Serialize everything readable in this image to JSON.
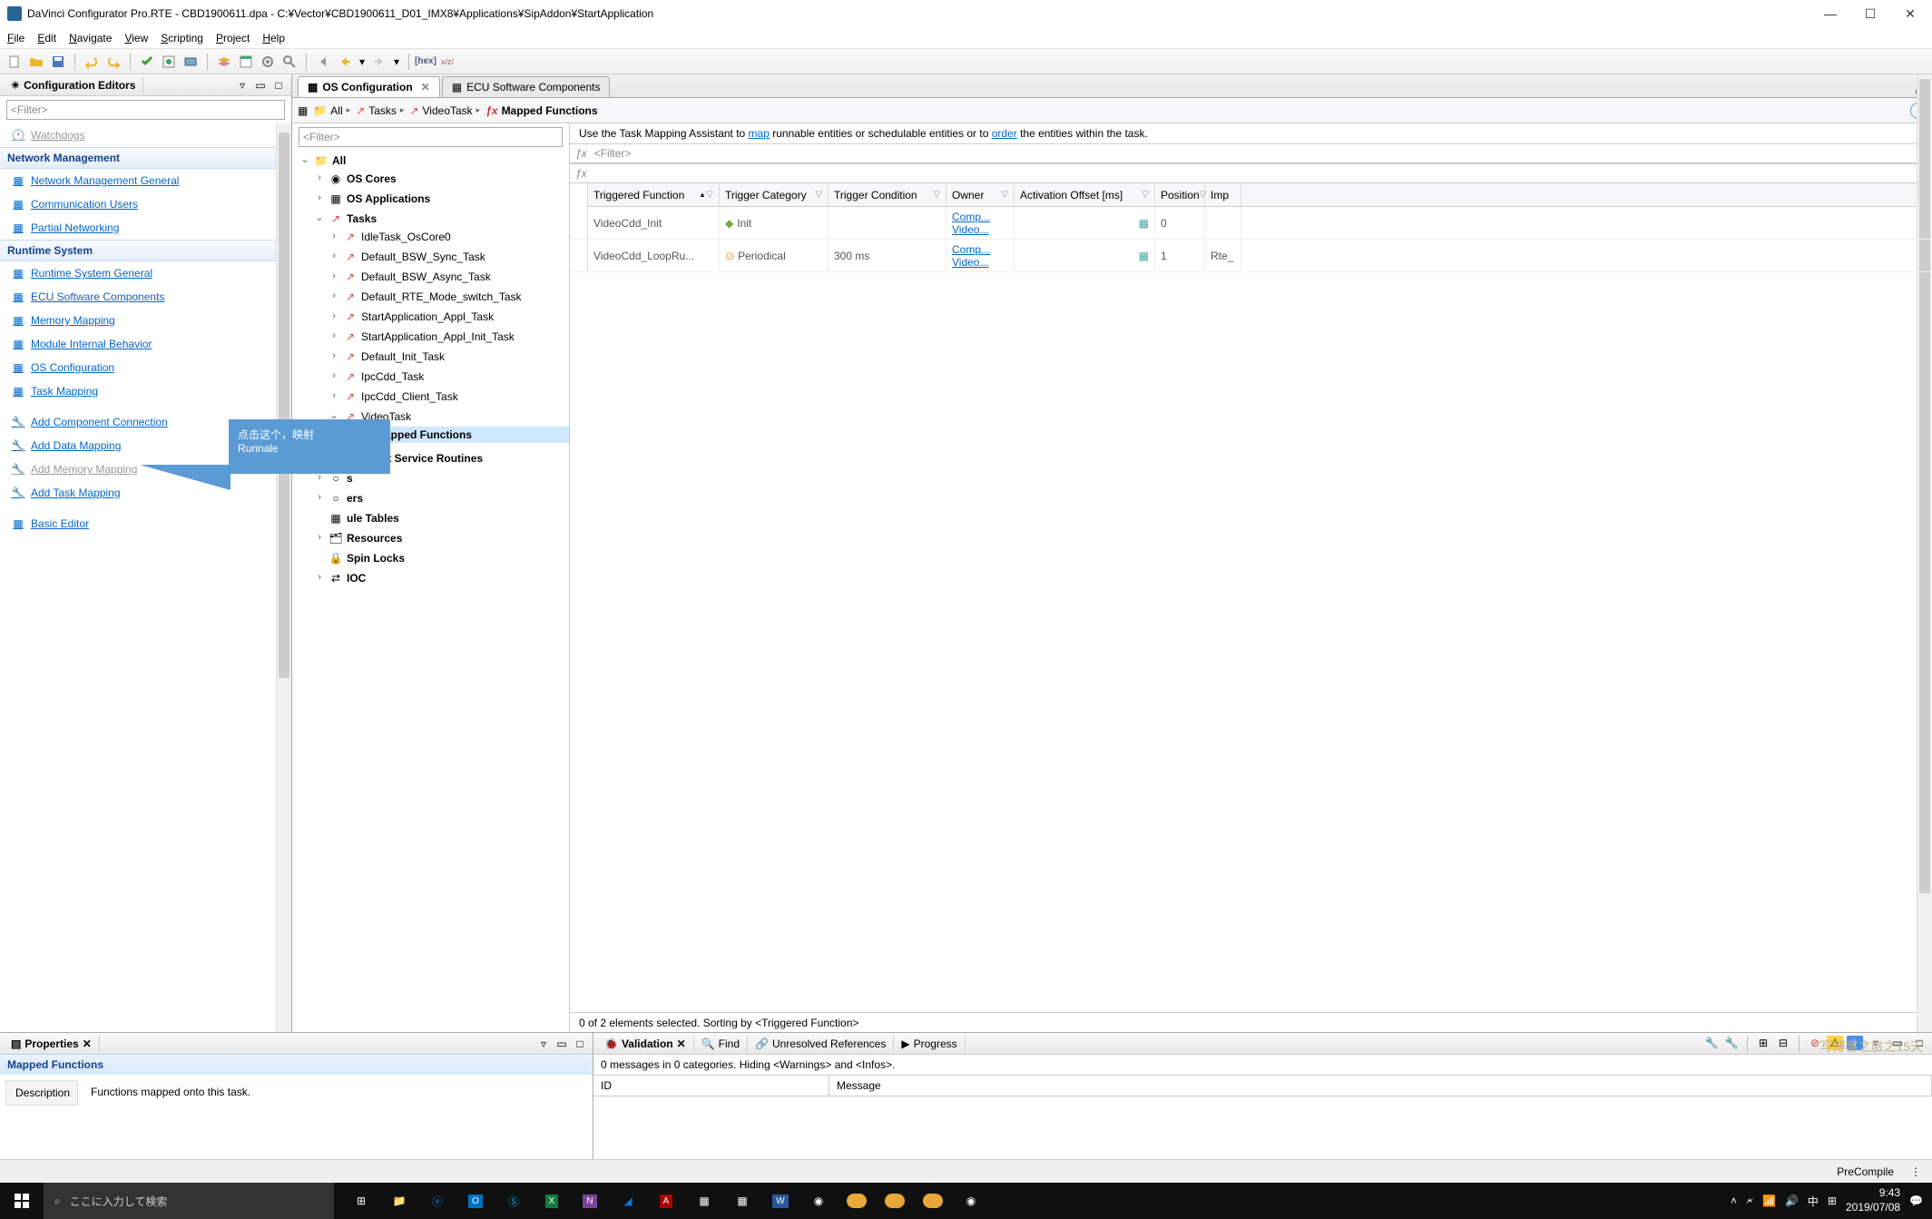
{
  "titlebar": {
    "text": "DaVinci Configurator Pro.RTE - CBD1900611.dpa - C:¥Vector¥CBD1900611_D01_IMX8¥Applications¥SipAddon¥StartApplication"
  },
  "menubar": {
    "file": "File",
    "edit": "Edit",
    "navigate": "Navigate",
    "view": "View",
    "scripting": "Scripting",
    "project": "Project",
    "help": "Help"
  },
  "config_editors": {
    "title": "Configuration Editors",
    "filter": "<Filter>",
    "watchdogs": "Watchdogs",
    "network_cat": "Network Management",
    "nm_general": "Network Management General",
    "comm_users": "Communication Users",
    "partial_net": "Partial Networking",
    "runtime_cat": "Runtime System",
    "rs_general": "Runtime System General",
    "ecu_sw": "ECU Software Components",
    "mem_map": "Memory Mapping",
    "module_behavior": "Module Internal Behavior",
    "os_config": "OS Configuration",
    "task_mapping": "Task Mapping",
    "add_comp": "Add Component Connection",
    "add_data": "Add Data Mapping",
    "add_mem": "Add Memory Mapping",
    "add_task": "Add Task Mapping",
    "basic_editor": "Basic Editor"
  },
  "editor": {
    "tab1": "OS Configuration",
    "tab2": "ECU Software Components",
    "bc_all": "All",
    "bc_tasks": "Tasks",
    "bc_vtask": "VideoTask",
    "bc_mf": "Mapped Functions"
  },
  "tree": {
    "filter": "<Filter>",
    "all": "All",
    "os_cores": "OS Cores",
    "os_apps": "OS Applications",
    "tasks": "Tasks",
    "idle": "IdleTask_OsCore0",
    "bsw_sync": "Default_BSW_Sync_Task",
    "bsw_async": "Default_BSW_Async_Task",
    "rte_mode": "Default_RTE_Mode_switch_Task",
    "appl": "StartApplication_Appl_Task",
    "appl_init": "StartApplication_Appl_Init_Task",
    "def_init": "Default_Init_Task",
    "ipc": "IpcCdd_Task",
    "ipc_client": "IpcCdd_Client_Task",
    "video": "VideoTask",
    "mapped_fn": "Mapped Functions",
    "isr": "Interrupt Service Routines",
    "suffix_s": "s",
    "suffix_ers": "ers",
    "sched": "ule Tables",
    "resources": "Resources",
    "spinlocks": "Spin Locks",
    "ioc": "IOC"
  },
  "hint": {
    "pre": "Use the Task Mapping Assistant to ",
    "map": "map",
    "mid": " runnable entities or schedulable entities or to ",
    "order": "order",
    "post": " the entities within the task."
  },
  "grid": {
    "filter": "<Filter>",
    "col_tf": "Triggered Function",
    "col_tc": "Trigger Category",
    "col_cond": "Trigger Condition",
    "col_owner": "Owner",
    "col_ao": "Activation Offset [ms]",
    "col_pos": "Position",
    "col_imp": "Imp",
    "r0_tf": "VideoCdd_Init",
    "r0_tc": "Init",
    "r0_owner1": "Comp...",
    "r0_owner2": "Video...",
    "r0_pos": "0",
    "r1_tf": "VideoCdd_LoopRu...",
    "r1_tc": "Periodical",
    "r1_cond": "300 ms",
    "r1_owner1": "Comp...",
    "r1_owner2": "Video...",
    "r1_pos": "1",
    "r1_imp": "Rte_",
    "status": "0 of 2 elements selected. Sorting by <Triggered Function>"
  },
  "properties": {
    "tab": "Properties",
    "title": "Mapped Functions",
    "desc_label": "Description",
    "desc_value": "Functions mapped onto this task."
  },
  "validation": {
    "tab_valid": "Validation",
    "tab_find": "Find",
    "tab_unres": "Unresolved References",
    "tab_prog": "Progress",
    "msg": "0 messages in 0 categories. Hiding <Warnings> and <Infos>.",
    "col_id": "ID",
    "col_msg": "Message"
  },
  "statusbar": {
    "precompile": "PreCompile"
  },
  "callout": {
    "line1": "点击这个，映射",
    "line2": "Runnale"
  },
  "taskbar": {
    "search": "ここに入力して検索",
    "time": "9:43",
    "date": "2019/07/08",
    "ime": "中"
  },
  "watermark": "写博客之旅之15天"
}
